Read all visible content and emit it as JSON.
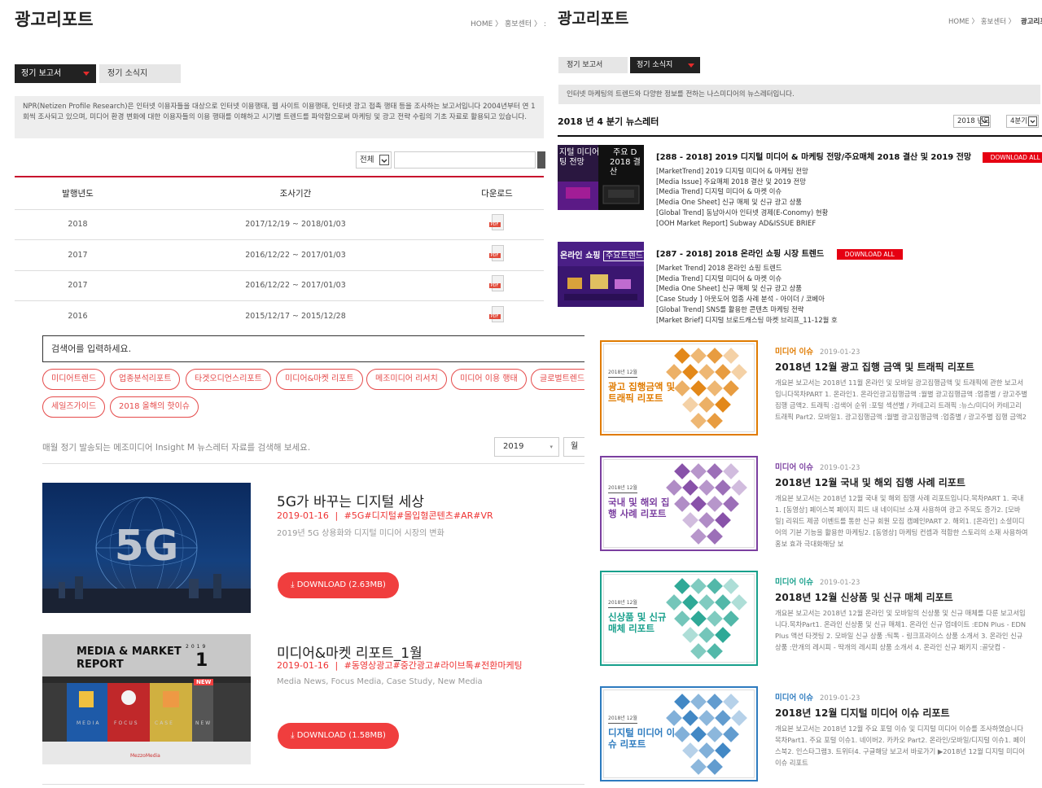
{
  "panel_a": {
    "title": "광고리포트",
    "breadcrumb": "HOME  〉 홍보센터  〉 :",
    "tab_active": "정기 보고서",
    "tab_inactive": "정기 소식지",
    "description": "NPR(Netizen Profile Research)은 인터넷 이용자들을 대상으로 인터넷 이용행태, 웹 사이트 이용행태, 인터넷 광고 접촉 행태 등을 조사하는 보고서입니다 2004년부터 연 1회씩 조사되고 있으며, 미디어 환경 변화에 대한 이용자들의 이용 행태를 이해하고 시기별 트렌드를 파악함으로써 마케팅 및 광고 전략 수립의 기초 자료로 활용되고 있습니다.",
    "filter_label": "전체",
    "columns": [
      "발행년도",
      "조사기간",
      "다운로드"
    ],
    "rows": [
      {
        "year": "2018",
        "period": "2017/12/19 ~ 2018/01/03"
      },
      {
        "year": "2017",
        "period": "2016/12/22 ~ 2017/01/03"
      },
      {
        "year": "2017",
        "period": "2016/12/22 ~ 2017/01/03"
      },
      {
        "year": "2016",
        "period": "2015/12/17 ~ 2015/12/28"
      }
    ],
    "pdf_label": "PDF"
  },
  "panel_b": {
    "title": "광고리포트",
    "breadcrumb": "HOME  〉 홍보센터  〉",
    "breadcrumb_current": "광고리포트",
    "tab_inactive": "정기 보고서",
    "tab_active": "정기 소식지",
    "description": "인터넷 마케팅의 트렌드와 다양한 정보를 전하는 나스미디어의 뉴스레터입니다.",
    "quarter_heading": "2018 년 4 분기 뉴스레터",
    "year_select": "2018 년도",
    "quarter_select": "4분기",
    "newsletters": [
      {
        "title": "[288 - 2018] 2019 디지털 미디어 & 마케팅 전망/주요매체 2018 결산 및 2019 전망",
        "button": "DOWNLOAD ALL",
        "thumb_text_1": "지털 미디어",
        "thumb_text_2": "팅 전망",
        "thumb_text_3": "주요 D",
        "thumb_text_4": "2018 결산",
        "items": [
          "[MarketTrend] 2019 디지털 미디어 & 마케팅 전망",
          "[Media Issue] 주요매체 2018 결산 및 2019 전망",
          "[Media Trend] 디지털 미디어 & 마켓 이슈",
          "[Media One Sheet] 신규 매체 및 신규 광고 상품",
          "[Global Trend] 동남아시아 인터넷 경제(E-Conomy) 현황",
          "[OOH Market Report] Subway AD&ISSUE BRIEF"
        ]
      },
      {
        "title": "[287 - 2018] 2018 온라인 쇼핑 시장 트렌드",
        "button": "DOWNLOAD ALL",
        "thumb_text_1": "온라인 쇼핑",
        "thumb_text_2": "주요트렌드",
        "items": [
          "[Market Trend] 2018 온라인 쇼핑 트렌드",
          "[Media Trend] 디지털 미디어 & 마켓 이슈",
          "[Media One Sheet] 신규 매체 및 신규 광고 상품",
          "[Case Study ] 아웃도어 업종 사례 분석 - 아이더 / 코베아",
          "[Global Trend] SNS를 활용한 콘텐츠 마케팅 전략",
          "[Market Brief] 디지털 브로드캐스팅 마켓 브리프_11-12월 호"
        ]
      }
    ]
  },
  "panel_c": {
    "search_placeholder": "검색어를 입력하세요.",
    "tags": [
      "미디어트렌드",
      "업종분석리포트",
      "타겟오디언스리포트",
      "미디어&마켓 리포트",
      "메조미디어 리서치",
      "미디어 이용 행태",
      "글로벌트렌드",
      "세일즈가이드",
      "2018 올해의 핫이슈"
    ],
    "hint": "매월 정기 발송되는 메조미디어 Insight M 뉴스레터 자료를 검색해 보세요.",
    "year_select": "2019",
    "month_select": "월",
    "reports": [
      {
        "title": "5G가 바꾸는 디지털 세상",
        "date": "2019-01-16",
        "tags": "#5G#디지털#몰입형콘텐츠#AR#VR",
        "summary": "2019년 5G 상용화와 디지털 미디어 시장의 변화",
        "download": "DOWNLOAD (2.63MB)",
        "thumb_label": "5G"
      },
      {
        "title": "미디어&마켓 리포트_1월",
        "date": "2019-01-16",
        "tags": "#동영상광고#중간광고#라이브톡#전환마케팅",
        "summary": "Media News, Focus Media, Case Study, New Media",
        "download": "DOWNLOAD (1.58MB)",
        "thumb_label": "MEDIA & MARKET REPORT",
        "thumb_year": "2019",
        "thumb_month": "1",
        "thumb_words": [
          "MEDIA",
          "FOCUS",
          "CASE",
          "NEW"
        ],
        "thumb_new": "NEW",
        "thumb_logo": "MezzoMedia"
      }
    ]
  },
  "panel_d": {
    "cards": [
      {
        "category": "미디어 이슈",
        "date": "2019-01-23",
        "title": "2018년 12월 광고 집행 금액 및 트래픽 리포트",
        "body": "개요본 보고서는 2018년 11월 온라인 및 모바일 광고집행금액 및 트래픽에 관한 보고서 입니다목차PART 1. 온라인1. 온라인광고집행금액 :월별 광고집행금액 :업종별 / 광고주별 집행 금액2. 트래픽 :검색어 순위 :포털 섹션별 / 카테고리 트래픽 :뉴스/미디어 카테고리 트래픽 Part2. 모바일1. 광고집행금액 :월별 광고집행금액 :업종별 / 광고주별 집행 금액2",
        "thumb_small": "2018년 12월",
        "thumb_big": "광고 집행금액 및 트래픽 리포트",
        "accent": "#e07b00"
      },
      {
        "category": "미디어 이슈",
        "date": "2019-01-23",
        "title": "2018년 12월 국내 및 해외 집행 사례 리포트",
        "body": "개요본 보고서는 2018년 12월 국내 및 해외 집행 사례 리포트입니다.목차PART 1. 국내1. [동영상] 페이스북 페이지 피드 내 네이티브 소재 사용하여 광고 주목도 증가2. [모바일] 리워드 제공 이벤트를 통한 신규 회원 모집 캠페인PART 2. 해외1. [온라인] 소셜미디어의 기본 기능을 활용한 마케팅2. [동영상] 마케팅 컨셉과 적합한 스토리의 소재 사용하여 홍보 효과 극대화해당 보",
        "thumb_small": "2018년 12월",
        "thumb_big": "국내 및 해외 집행 사례 리포트",
        "accent": "#7b3fa0"
      },
      {
        "category": "미디어 이슈",
        "date": "2019-01-23",
        "title": "2018년 12월 신상품 및 신규 매체 리포트",
        "body": "개요본 보고서는 2018년 12월 온라인 및 모바일의 신상품 및 신규 매체를 다룬 보고서입니다.목차Part1. 온라인 신상품 및 신규 매체1. 온라인 신규 업데이트 :EDN Plus - EDN Plus 액션 타겟팅 2. 모바일 신규 상품 :틱톡 - 링크프라이스 상품 소개서 3. 온라인 신규 상품 :만개의 레시피 - 딱개의 레시피 상품 소개서 4. 온라인 신규 패키지 :골닷컴 -",
        "thumb_small": "2018년 12월",
        "thumb_big": "신상품 및 신규 매체 리포트",
        "accent": "#18a08c"
      },
      {
        "category": "미디어 이슈",
        "date": "2019-01-23",
        "title": "2018년 12월 디지털 미디어 이슈 리포트",
        "body": "개요본 보고서는 2018년 12월 주요 포털 이슈 및 디지털 미디어 이슈를 조사하였습니다목차Part1. 주요 포털 이슈1. 네이버2. 카카오 Part2. 온라인/모바일/디지털 이슈1. 페이스북2. 인스타그램3. 트위터4. 구글해당 보고서 바로가기 ▶2018년 12월 디지털 미디어 이슈 리포트",
        "thumb_small": "2018년 12월",
        "thumb_big": "디지털 미디어 이슈 리포트",
        "accent": "#2d7bbf"
      }
    ]
  }
}
